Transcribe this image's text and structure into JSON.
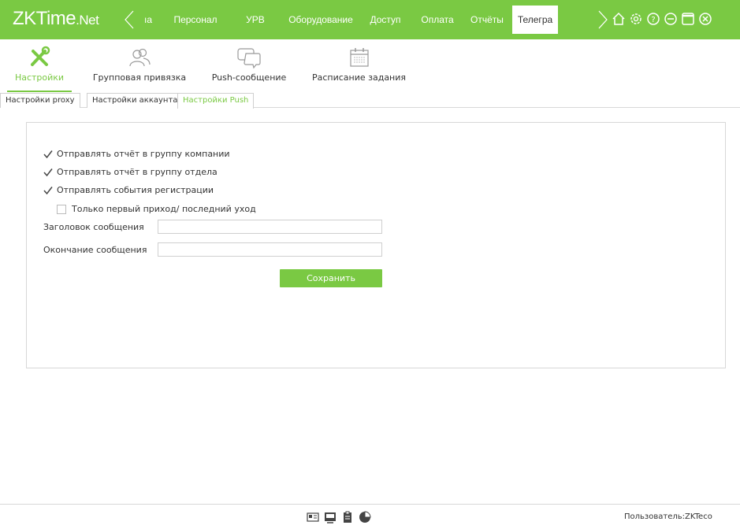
{
  "app": {
    "logo_zk": "ZK",
    "logo_time": "Time",
    "logo_net": ".Net"
  },
  "menu": [
    {
      "label": "ıa",
      "name": "menu-item-partial"
    },
    {
      "label": "Персонал",
      "name": "menu-item-personnel"
    },
    {
      "label": "УРВ",
      "name": "menu-item-urv"
    },
    {
      "label": "Оборудование",
      "name": "menu-item-equipment"
    },
    {
      "label": "Доступ",
      "name": "menu-item-access"
    },
    {
      "label": "Оплата",
      "name": "menu-item-payment"
    },
    {
      "label": "Отчёты",
      "name": "menu-item-reports"
    },
    {
      "label": "Телегра",
      "name": "menu-item-telegram",
      "active": true
    }
  ],
  "top_icons": [
    "home-icon",
    "gear-icon",
    "help-icon",
    "minimize-icon",
    "maximize-icon",
    "close-icon"
  ],
  "toolbar": {
    "settings": "Настройки",
    "group_binding": "Групповая привязка",
    "push_message": "Push-сообщение",
    "task_schedule": "Расписание задания"
  },
  "subtabs": {
    "proxy": "Настройки proxy",
    "account": "Настройки аккаунта",
    "push": "Настройки Push"
  },
  "form": {
    "send_company": "Отправлять отчёт в группу компании",
    "send_department": "Отправлять отчёт в группу отдела",
    "send_events": "Отправлять события регистрации",
    "first_last_only": "Только первый приход/ последний уход",
    "header_label": "Заголовок сообщения",
    "header_value": "",
    "footer_label": "Окончание сообщения",
    "footer_value": "",
    "save": "Сохранить",
    "checks": {
      "send_company": true,
      "send_department": true,
      "send_events": true,
      "first_last_only": false
    }
  },
  "status": {
    "user": "Пользователь:ZKTeco"
  },
  "colors": {
    "accent": "#7ac943",
    "topbar": "#7ac943"
  }
}
